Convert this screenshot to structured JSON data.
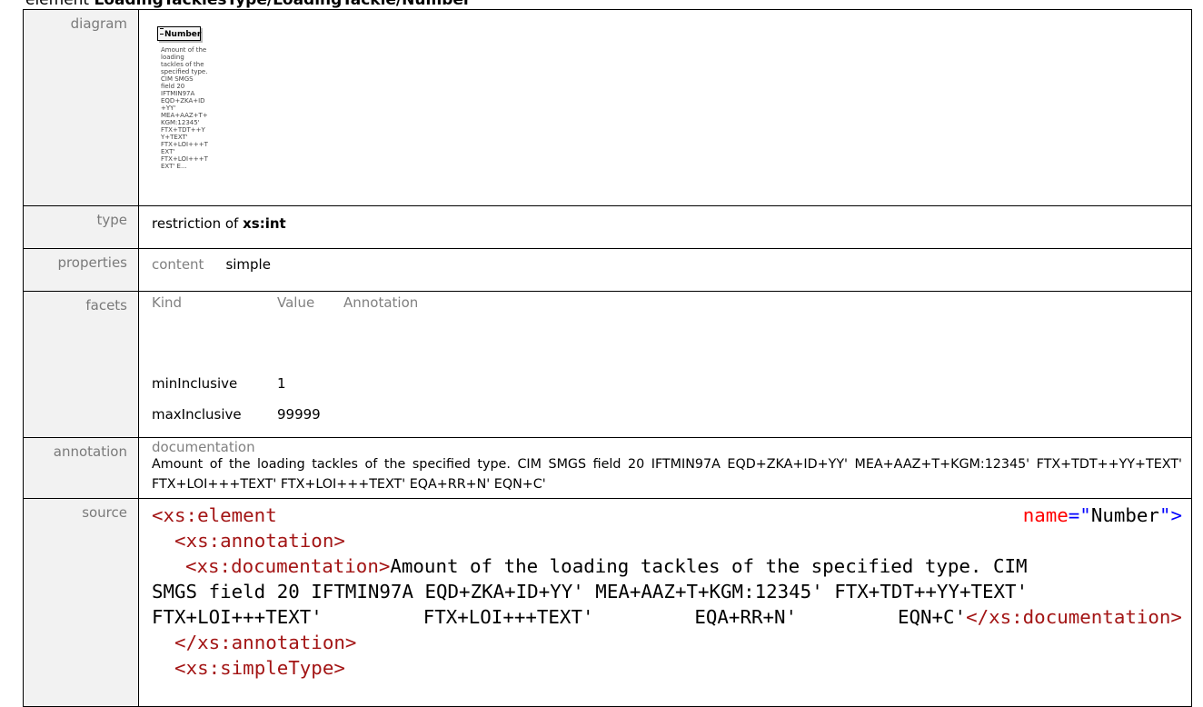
{
  "heading": {
    "prefix": "element",
    "path": "LoadingTacklesType/LoadingTackle/Number"
  },
  "labels": {
    "diagram": "diagram",
    "type": "type",
    "properties": "properties",
    "facets": "facets",
    "annotation": "annotation",
    "source": "source"
  },
  "diagram": {
    "element_name": "Number",
    "doc_snippet": "Amount of the loading tackles of the specified type. CIM SMGS field 20 IFTMIN97A EQD+ZKA+ID+YY' MEA+AAZ+T+KGM:12345' FTX+TDT++YY+TEXT' FTX+LOI+++TEXT' FTX+LOI+++TEXT' E..."
  },
  "type": {
    "prefix": "restriction of",
    "base": "xs:int"
  },
  "properties": {
    "key": "content",
    "value": "simple"
  },
  "facets": {
    "headers": [
      "Kind",
      "Value",
      "Annotation"
    ],
    "rows": [
      {
        "kind": "minInclusive",
        "value": "1"
      },
      {
        "kind": "maxInclusive",
        "value": "99999"
      }
    ]
  },
  "annotation": {
    "heading": "documentation",
    "text": "Amount of the loading tackles of the specified type. CIM SMGS field 20 IFTMIN97A EQD+ZKA+ID+YY' MEA+AAZ+T+KGM:12345' FTX+TDT++YY+TEXT' FTX+LOI+++TEXT' FTX+LOI+++TEXT' EQA+RR+N' EQN+C'"
  },
  "source": {
    "l1_tag": "<xs:element",
    "l1_attr": "name",
    "l1_eq": "=\"",
    "l1_val": "Number",
    "l1_close": "\">",
    "l2": "<xs:annotation>",
    "l3_open": "<xs:documentation>",
    "l3_text": "Amount of the loading tackles of the specified type. CIM",
    "l4_text": "SMGS field 20 IFTMIN97A EQD+ZKA+ID+YY' MEA+AAZ+T+KGM:12345' FTX+TDT++YY+TEXT'",
    "l5_a": "FTX+LOI+++TEXT'",
    "l5_b": "FTX+LOI+++TEXT'",
    "l5_c": "EQA+RR+N'",
    "l5_d": "EQN+C'",
    "l5_close": "</xs:documentation>",
    "l6": "</xs:annotation>",
    "l7": "<xs:simpleType>"
  }
}
